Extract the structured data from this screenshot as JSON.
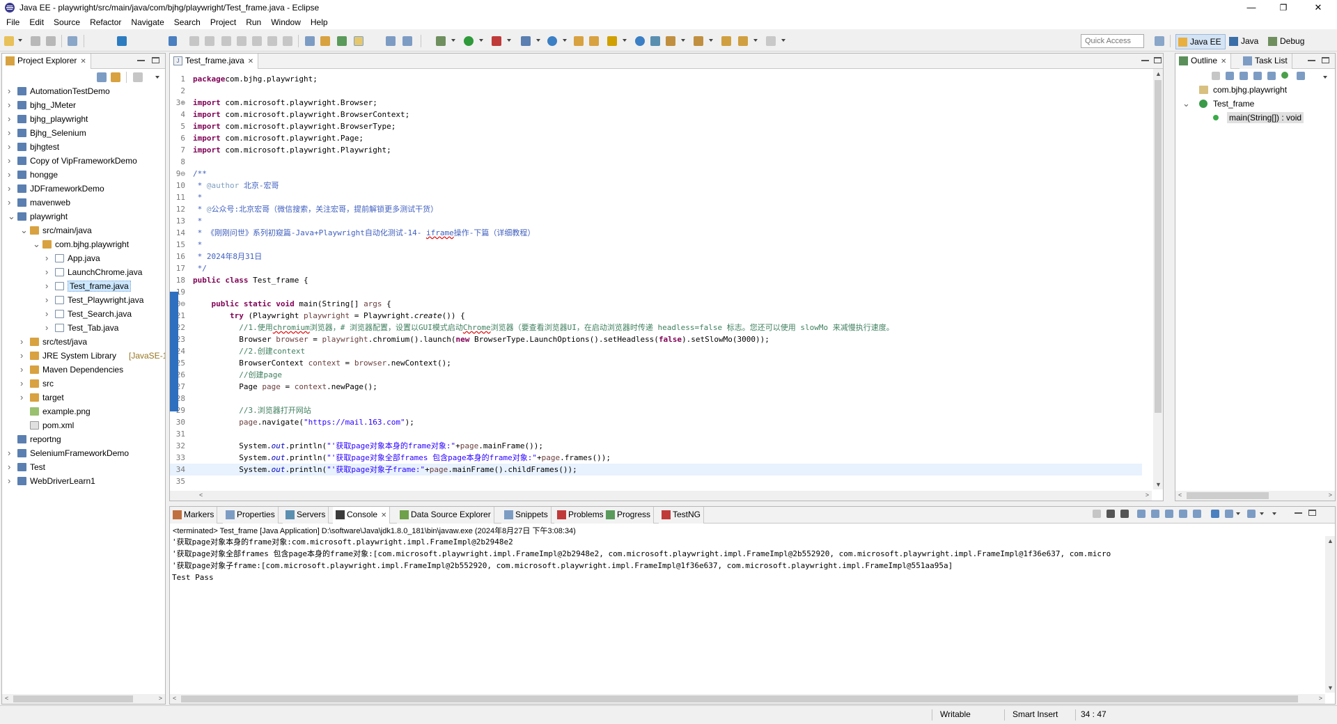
{
  "window": {
    "title": "Java EE - playwright/src/main/java/com/bjhg/playwright/Test_frame.java - Eclipse",
    "minimize": "—",
    "restore": "❐",
    "close": "✕"
  },
  "menubar": [
    "File",
    "Edit",
    "Source",
    "Refactor",
    "Navigate",
    "Search",
    "Project",
    "Run",
    "Window",
    "Help"
  ],
  "toolbar": {
    "quick_access_placeholder": "Quick Access"
  },
  "perspectives": [
    {
      "label": "Java EE",
      "active": true
    },
    {
      "label": "Java",
      "active": false
    },
    {
      "label": "Debug",
      "active": false
    }
  ],
  "project_explorer": {
    "tab_label": "Project Explorer",
    "items": [
      {
        "label": "AutomationTestDemo",
        "depth": 0,
        "expanded": false
      },
      {
        "label": "bjhg_JMeter",
        "depth": 0,
        "expanded": false
      },
      {
        "label": "bjhg_playwright",
        "depth": 0,
        "expanded": false
      },
      {
        "label": "Bjhg_Selenium",
        "depth": 0,
        "expanded": false
      },
      {
        "label": "bjhgtest",
        "depth": 0,
        "expanded": false
      },
      {
        "label": "Copy of VipFrameworkDemo",
        "depth": 0,
        "expanded": false
      },
      {
        "label": "hongge",
        "depth": 0,
        "expanded": false
      },
      {
        "label": "JDFrameworkDemo",
        "depth": 0,
        "expanded": false
      },
      {
        "label": "mavenweb",
        "depth": 0,
        "expanded": false
      },
      {
        "label": "playwright",
        "depth": 0,
        "expanded": true
      },
      {
        "label": "src/main/java",
        "depth": 1,
        "expanded": true
      },
      {
        "label": "com.bjhg.playwright",
        "depth": 2,
        "expanded": true
      },
      {
        "label": "App.java",
        "depth": 3,
        "expanded": false
      },
      {
        "label": "LaunchChrome.java",
        "depth": 3,
        "expanded": false
      },
      {
        "label": "Test_frame.java",
        "depth": 3,
        "expanded": false,
        "selected": true
      },
      {
        "label": "Test_Playwright.java",
        "depth": 3,
        "expanded": false
      },
      {
        "label": "Test_Search.java",
        "depth": 3,
        "expanded": false
      },
      {
        "label": "Test_Tab.java",
        "depth": 3,
        "expanded": false
      },
      {
        "label": "src/test/java",
        "depth": 1,
        "expanded": false
      },
      {
        "label": "JRE System Library",
        "decor": "[JavaSE-1.",
        "depth": 1,
        "expanded": false
      },
      {
        "label": "Maven Dependencies",
        "depth": 1,
        "expanded": false
      },
      {
        "label": "src",
        "depth": 1,
        "expanded": false
      },
      {
        "label": "target",
        "depth": 1,
        "expanded": false
      },
      {
        "label": "example.png",
        "depth": 1,
        "leaf": true
      },
      {
        "label": "pom.xml",
        "depth": 1,
        "leaf": true
      },
      {
        "label": "reportng",
        "depth": 0,
        "leaf": true
      },
      {
        "label": "SeleniumFrameworkDemo",
        "depth": 0,
        "expanded": false
      },
      {
        "label": "Test",
        "depth": 0,
        "expanded": false
      },
      {
        "label": "WebDriverLearn1",
        "depth": 0,
        "expanded": false
      }
    ]
  },
  "editor": {
    "tab_label": "Test_frame.java",
    "lines": [
      {
        "n": "1",
        "segs": [
          [
            "kw",
            "package"
          ],
          [
            "",
            "com.bjhg.playwright;"
          ]
        ]
      },
      {
        "n": "2",
        "segs": []
      },
      {
        "n": "3⊕",
        "segs": [
          [
            "kw",
            "import"
          ],
          [
            "",
            " com.microsoft.playwright.Browser;"
          ]
        ]
      },
      {
        "n": "4",
        "segs": [
          [
            "kw",
            "import"
          ],
          [
            "",
            " com.microsoft.playwright.BrowserContext;"
          ]
        ]
      },
      {
        "n": "5",
        "segs": [
          [
            "kw",
            "import"
          ],
          [
            "",
            " com.microsoft.playwright.BrowserType;"
          ]
        ]
      },
      {
        "n": "6",
        "segs": [
          [
            "kw",
            "import"
          ],
          [
            "",
            " com.microsoft.playwright.Page;"
          ]
        ]
      },
      {
        "n": "7",
        "segs": [
          [
            "kw",
            "import"
          ],
          [
            "",
            " com.microsoft.playwright.Playwright;"
          ]
        ]
      },
      {
        "n": "8",
        "segs": []
      },
      {
        "n": "9⊖",
        "segs": [
          [
            "jd",
            "/**"
          ]
        ]
      },
      {
        "n": "10",
        "segs": [
          [
            "jd",
            " * "
          ],
          [
            "ann",
            "@author"
          ],
          [
            "jd",
            " 北京-宏哥"
          ]
        ]
      },
      {
        "n": "11",
        "segs": [
          [
            "jd",
            " *"
          ]
        ]
      },
      {
        "n": "12",
        "segs": [
          [
            "jd",
            " * "
          ],
          [
            "ann",
            "@"
          ],
          [
            "jd",
            "公众号:北京宏哥（微信搜索，关注宏哥，提前解锁更多测试干货）"
          ]
        ]
      },
      {
        "n": "13",
        "segs": [
          [
            "jd",
            " *"
          ]
        ]
      },
      {
        "n": "14",
        "segs": [
          [
            "jd",
            " * 《刚刚问世》系列初窥篇-Java+Playwright自动化测试-14- "
          ],
          [
            "jd ul",
            "iframe"
          ],
          [
            "jd",
            "操作-下篇（详细教程）"
          ]
        ]
      },
      {
        "n": "15",
        "segs": [
          [
            "jd",
            " *"
          ]
        ]
      },
      {
        "n": "16",
        "segs": [
          [
            "jd",
            " * 2024年8月31日"
          ]
        ]
      },
      {
        "n": "17",
        "segs": [
          [
            "jd",
            " */"
          ]
        ]
      },
      {
        "n": "18",
        "segs": [
          [
            "kw",
            "public class"
          ],
          [
            "",
            " Test_frame {"
          ]
        ]
      },
      {
        "n": "19",
        "segs": []
      },
      {
        "n": "20⊖",
        "segs": [
          [
            "",
            "    "
          ],
          [
            "kw",
            "public static void"
          ],
          [
            "",
            " main(String[] "
          ],
          [
            "var",
            "args"
          ],
          [
            "",
            " {"
          ]
        ]
      },
      {
        "n": "21",
        "segs": [
          [
            "",
            "        "
          ],
          [
            "kw",
            "try"
          ],
          [
            "",
            " (Playwright "
          ],
          [
            "var",
            "playwright"
          ],
          [
            "",
            " = Playwright."
          ],
          [
            "i",
            "create"
          ],
          [
            "",
            "()) {"
          ]
        ]
      },
      {
        "n": "22",
        "segs": [
          [
            "",
            "          "
          ],
          [
            "cm",
            "//1.使用"
          ],
          [
            "cm ul",
            "chromium"
          ],
          [
            "cm",
            "浏览器，# 浏览器配置，设置以GUI模式启动"
          ],
          [
            "cm ul",
            "Chrome"
          ],
          [
            "cm",
            "浏览器（要查看浏览器UI，在启动浏览器时传递 headless=false 标志。您还可以使用 slowMo 来减慢执行速度。"
          ]
        ]
      },
      {
        "n": "23",
        "segs": [
          [
            "",
            "          Browser "
          ],
          [
            "var",
            "browser"
          ],
          [
            "",
            " = "
          ],
          [
            "var",
            "playwright"
          ],
          [
            "",
            ".chromium().launch("
          ],
          [
            "kw",
            "new"
          ],
          [
            "",
            " BrowserType.LaunchOptions().setHeadless("
          ],
          [
            "kw",
            "false"
          ],
          [
            "",
            ").setSlowMo(3000));"
          ]
        ]
      },
      {
        "n": "24",
        "segs": [
          [
            "",
            "          "
          ],
          [
            "cm",
            "//2.创建context"
          ]
        ]
      },
      {
        "n": "25",
        "segs": [
          [
            "",
            "          BrowserContext "
          ],
          [
            "var",
            "context"
          ],
          [
            "",
            " = "
          ],
          [
            "var",
            "browser"
          ],
          [
            "",
            ".newContext();"
          ]
        ]
      },
      {
        "n": "26",
        "segs": [
          [
            "",
            "          "
          ],
          [
            "cm",
            "//创建page"
          ]
        ]
      },
      {
        "n": "27",
        "segs": [
          [
            "",
            "          Page "
          ],
          [
            "var",
            "page"
          ],
          [
            "",
            " = "
          ],
          [
            "var",
            "context"
          ],
          [
            "",
            ".newPage();"
          ]
        ]
      },
      {
        "n": "28",
        "segs": []
      },
      {
        "n": "29",
        "segs": [
          [
            "",
            "          "
          ],
          [
            "cm",
            "//3.浏览器打开网站"
          ]
        ]
      },
      {
        "n": "30",
        "segs": [
          [
            "",
            "          "
          ],
          [
            "var",
            "page"
          ],
          [
            "",
            ".navigate("
          ],
          [
            "st",
            "\"https://mail.163.com\""
          ],
          [
            "",
            ");"
          ]
        ]
      },
      {
        "n": "31",
        "segs": []
      },
      {
        "n": "32",
        "segs": [
          [
            "",
            "          System."
          ],
          [
            "fld",
            "out"
          ],
          [
            "",
            ".println("
          ],
          [
            "st",
            "\"'获取page对象本身的frame对象:\""
          ],
          [
            "",
            "+"
          ],
          [
            "var",
            "page"
          ],
          [
            "",
            ".mainFrame());"
          ]
        ]
      },
      {
        "n": "33",
        "segs": [
          [
            "",
            "          System."
          ],
          [
            "fld",
            "out"
          ],
          [
            "",
            ".println("
          ],
          [
            "st",
            "\"'获取page对象全部frames 包含page本身的frame对象:\""
          ],
          [
            "",
            "+"
          ],
          [
            "var",
            "page"
          ],
          [
            "",
            ".frames());"
          ]
        ]
      },
      {
        "n": "34",
        "segs": [
          [
            "",
            "          System."
          ],
          [
            "fld",
            "out"
          ],
          [
            "",
            ".println("
          ],
          [
            "st",
            "\"'获取page对象子frame:\""
          ],
          [
            "",
            "+"
          ],
          [
            "var",
            "page"
          ],
          [
            "",
            ".mainFrame().childFrames());"
          ]
        ],
        "current": true
      },
      {
        "n": "35",
        "segs": []
      }
    ]
  },
  "outline": {
    "tabs": [
      "Outline",
      "Task List"
    ],
    "items": [
      {
        "label": "com.bjhg.playwright",
        "depth": 0
      },
      {
        "label": "Test_frame",
        "depth": 0,
        "expanded": true
      },
      {
        "label": "main(String[]) : void",
        "depth": 1,
        "selected": true
      }
    ]
  },
  "bottom_panel": {
    "tabs": [
      {
        "label": "Markers",
        "active": false
      },
      {
        "label": "Properties",
        "active": false
      },
      {
        "label": "Servers",
        "active": false
      },
      {
        "label": "Console",
        "active": true
      },
      {
        "label": "Data Source Explorer",
        "active": false
      },
      {
        "label": "Snippets",
        "active": false
      },
      {
        "label": "Problems",
        "active": false
      },
      {
        "label": "Progress",
        "active": false
      },
      {
        "label": "TestNG",
        "active": false
      }
    ],
    "console_header": "<terminated> Test_frame [Java Application] D:\\software\\Java\\jdk1.8.0_181\\bin\\javaw.exe (2024年8月27日 下午3:08:34)",
    "console_lines": [
      "'获取page对象本身的frame对象:com.microsoft.playwright.impl.FrameImpl@2b2948e2",
      "'获取page对象全部frames 包含page本身的frame对象:[com.microsoft.playwright.impl.FrameImpl@2b2948e2, com.microsoft.playwright.impl.FrameImpl@2b552920, com.microsoft.playwright.impl.FrameImpl@1f36e637, com.micro",
      "'获取page对象子frame:[com.microsoft.playwright.impl.FrameImpl@2b552920, com.microsoft.playwright.impl.FrameImpl@1f36e637, com.microsoft.playwright.impl.FrameImpl@551aa95a]",
      "Test Pass"
    ]
  },
  "statusbar": {
    "writable": "Writable",
    "insert_mode": "Smart Insert",
    "position": "34 : 47"
  },
  "colors": {
    "keyword": "#7f0055",
    "comment": "#3f7f5f",
    "javadoc": "#3f5fbf",
    "string": "#2a00ff",
    "field": "#0000c0",
    "local_var": "#6a3e3e",
    "selection": "#cde8ff",
    "current_line": "#e8f2fe"
  }
}
